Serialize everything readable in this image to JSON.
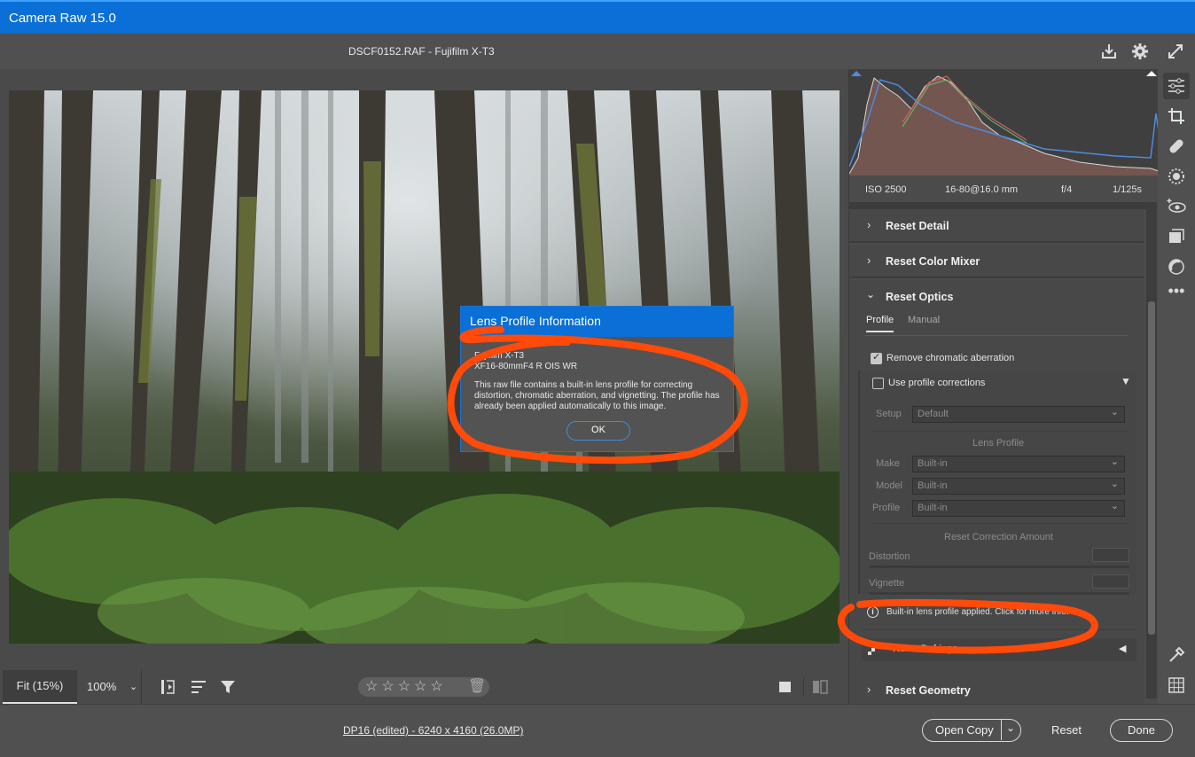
{
  "app": {
    "title": "Camera Raw 15.0"
  },
  "header": {
    "filename": "DSCF0152.RAF  -  Fujifilm X-T3"
  },
  "viewer": {
    "fit_label": "Fit (15%)",
    "zoom_label": "100%",
    "rating_stars": "☆☆☆☆☆"
  },
  "exif": {
    "iso": "ISO 2500",
    "lens": "16-80@16.0 mm",
    "aperture": "f/4",
    "shutter": "1/125s"
  },
  "sections": {
    "detail": "Reset Detail",
    "color_mixer": "Reset Color Mixer",
    "optics": "Reset Optics",
    "geometry": "Reset Geometry"
  },
  "optics": {
    "tabs": [
      "Profile",
      "Manual"
    ],
    "remove_ca": "Remove chromatic aberration",
    "use_profile": "Use profile corrections",
    "setup_label": "Setup",
    "setup_value": "Default",
    "lens_profile_heading": "Lens Profile",
    "make_label": "Make",
    "make_value": "Built-in",
    "model_label": "Model",
    "model_value": "Built-in",
    "profile_label": "Profile",
    "profile_value": "Built-in",
    "reset_correction": "Reset Correction Amount",
    "distortion_label": "Distortion",
    "vignette_label": "Vignette",
    "info_text": "Built-in lens profile applied.  Click for more info.",
    "defringe_label": "Reset Defringe"
  },
  "dialog": {
    "title": "Lens Profile Information",
    "camera": "Fujifilm X-T3",
    "lens": "XF16-80mmF4 R OIS WR",
    "message": "This raw file contains a built-in lens profile for correcting distortion, chromatic aberration, and vignetting. The profile has already been applied automatically to this image.",
    "ok_label": "OK"
  },
  "footer": {
    "info_link": "DP16 (edited) - 6240 x 4160 (26.0MP)",
    "open_copy": "Open Copy",
    "reset": "Reset",
    "done": "Done"
  },
  "colors": {
    "accent": "#0a6fd6",
    "annotation": "#ff4a0a"
  }
}
